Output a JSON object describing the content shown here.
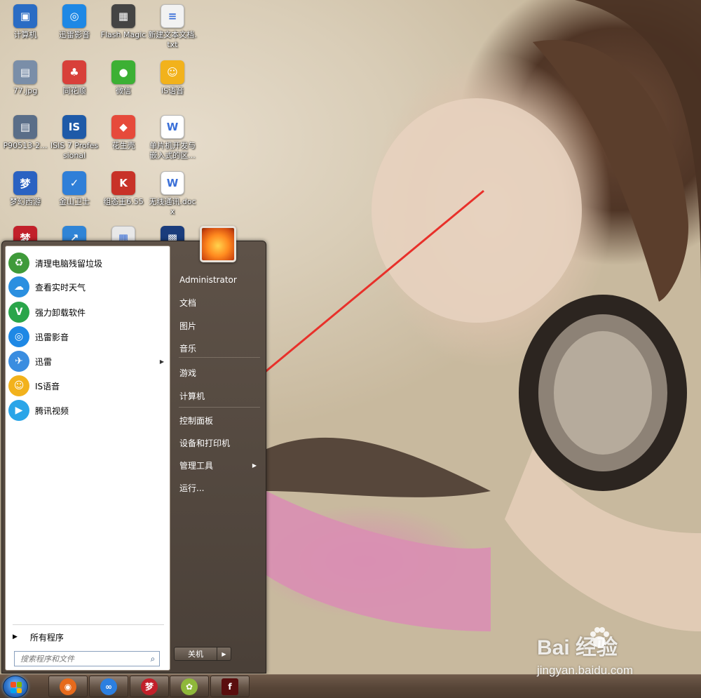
{
  "desktop": {
    "icons": [
      {
        "label": "计算机",
        "color": "#2a6cc4",
        "glyph": "▣"
      },
      {
        "label": "迅雷影音",
        "color": "#1e88e5",
        "glyph": "◎"
      },
      {
        "label": "Flash Magic",
        "color": "#444444",
        "glyph": "▦"
      },
      {
        "label": "新建文本文档.txt",
        "color": "#f2f2f2",
        "glyph": "≡"
      },
      {
        "label": "77.jpg",
        "color": "#7a8ea8",
        "glyph": "▤"
      },
      {
        "label": "同花顺",
        "color": "#d8403a",
        "glyph": "♣"
      },
      {
        "label": "微信",
        "color": "#3cb034",
        "glyph": "●"
      },
      {
        "label": "IS语音",
        "color": "#f2b21c",
        "glyph": "☺"
      },
      {
        "label": "P90513-2...",
        "color": "#5a6e88",
        "glyph": "▤"
      },
      {
        "label": "ISIS 7 Professional",
        "color": "#1e5aa8",
        "glyph": "IS"
      },
      {
        "label": "花生壳",
        "color": "#e64a3b",
        "glyph": "◆"
      },
      {
        "label": "单片机开发与嵌入式的区...",
        "color": "#ffffff",
        "glyph": "W"
      },
      {
        "label": "梦幻西游",
        "color": "#2a62c2",
        "glyph": "梦"
      },
      {
        "label": "金山卫士",
        "color": "#2f7fd8",
        "glyph": "✓"
      },
      {
        "label": "组态王6.55",
        "color": "#c83228",
        "glyph": "K"
      },
      {
        "label": "无线通讯.docx",
        "color": "#ffffff",
        "glyph": "W"
      },
      {
        "label": "",
        "color": "#c2202a",
        "glyph": "梦"
      },
      {
        "label": "",
        "color": "#2f84d6",
        "glyph": "↗"
      },
      {
        "label": "",
        "color": "#e8e8e8",
        "glyph": "▦"
      },
      {
        "label": "",
        "color": "#1a3c7c",
        "glyph": "▩"
      }
    ]
  },
  "start_menu": {
    "programs": [
      {
        "label": "清理电脑残留垃圾",
        "color": "#3f9a3a",
        "glyph": "♻"
      },
      {
        "label": "查看实时天气",
        "color": "#2a8fe0",
        "glyph": "☁"
      },
      {
        "label": "强力卸载软件",
        "color": "#2aa54a",
        "glyph": "V"
      },
      {
        "label": "迅雷影音",
        "color": "#1e88e5",
        "glyph": "◎"
      },
      {
        "label": "迅雷",
        "color": "#3a8de0",
        "glyph": "✈",
        "submenu": true
      },
      {
        "label": "IS语音",
        "color": "#f2b21c",
        "glyph": "☺"
      },
      {
        "label": "腾讯视频",
        "color": "#2aa5e8",
        "glyph": "▶"
      }
    ],
    "all_programs": "所有程序",
    "search_placeholder": "搜索程序和文件",
    "right_items": [
      {
        "label": "Administrator"
      },
      {
        "label": "文档"
      },
      {
        "label": "图片"
      },
      {
        "label": "音乐"
      },
      {
        "label": "游戏"
      },
      {
        "label": "计算机"
      },
      {
        "label": "控制面板"
      },
      {
        "label": "设备和打印机"
      },
      {
        "label": "管理工具",
        "submenu": true
      },
      {
        "label": "运行..."
      }
    ],
    "shutdown_label": "关机"
  },
  "taskbar": {
    "buttons": [
      {
        "name": "firefox",
        "color": "#e66a1c",
        "glyph": "◉"
      },
      {
        "name": "baidu-netdisk",
        "color": "#2c7fe0",
        "glyph": "∞"
      },
      {
        "name": "mhxy",
        "color": "#c2202a",
        "glyph": "梦"
      },
      {
        "name": "peanut",
        "color": "#8fb83a",
        "glyph": "✿"
      },
      {
        "name": "flash",
        "color": "#5a0e0e",
        "glyph": "f"
      }
    ]
  },
  "watermark": {
    "main": "Bai  经验",
    "sub": "jingyan.baidu.com"
  },
  "colors": {
    "annotation_arrow": "#e8302a"
  }
}
